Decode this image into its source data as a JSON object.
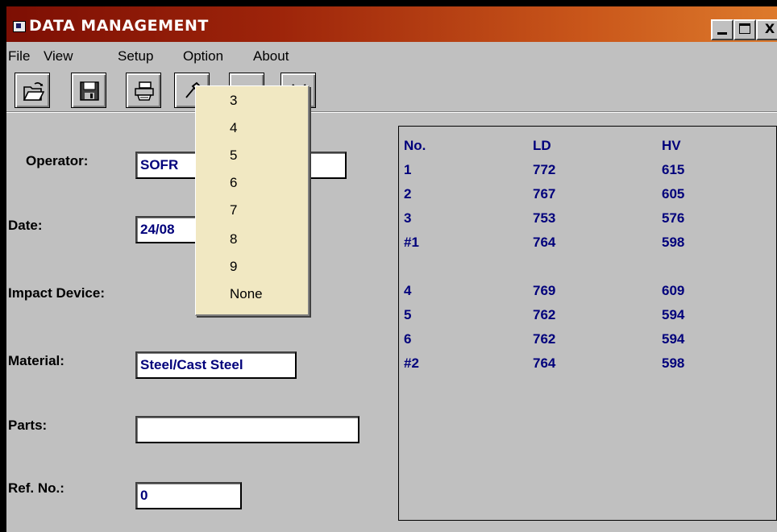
{
  "window": {
    "title": "DATA MANAGEMENT",
    "controls": {
      "minimize": "_",
      "close": "X"
    }
  },
  "menu": [
    "File",
    "View",
    "Setup",
    "Option",
    "About"
  ],
  "toolbar": {
    "buttons": [
      "open-icon",
      "save-icon",
      "print-icon",
      "settings-icon",
      "blank-icon",
      "delete-icon"
    ]
  },
  "form": {
    "operator_label": "Operator:",
    "operator_value": "SOFR",
    "date_label": "Date:",
    "date_value": "24/08",
    "impact_device_label": "Impact Device:",
    "material_label": "Material:",
    "material_value": "Steel/Cast Steel",
    "parts_label": "Parts:",
    "parts_value": "",
    "ref_label": "Ref. No.:",
    "ref_value": "0"
  },
  "results": {
    "headers": [
      "No.",
      "LD",
      "HV"
    ],
    "rows": [
      [
        "1",
        "772",
        "615"
      ],
      [
        "2",
        "767",
        "605"
      ],
      [
        "3",
        "753",
        "576"
      ],
      [
        "#1",
        "764",
        "598"
      ],
      [
        "",
        "",
        ""
      ],
      [
        "4",
        "769",
        "609"
      ],
      [
        "5",
        "762",
        "594"
      ],
      [
        "6",
        "762",
        "594"
      ],
      [
        "#2",
        "764",
        "598"
      ]
    ]
  },
  "dropdown": {
    "options": [
      "3",
      "4",
      "5",
      "6",
      "7",
      "8",
      "9",
      "None"
    ]
  },
  "colors": {
    "title_gradient_start": "#7d0f04",
    "title_gradient_end": "#dd7a2c",
    "window_bg": "#c0c0c0",
    "value_text": "#00007b",
    "dropdown_bg": "#f1e8c2"
  }
}
